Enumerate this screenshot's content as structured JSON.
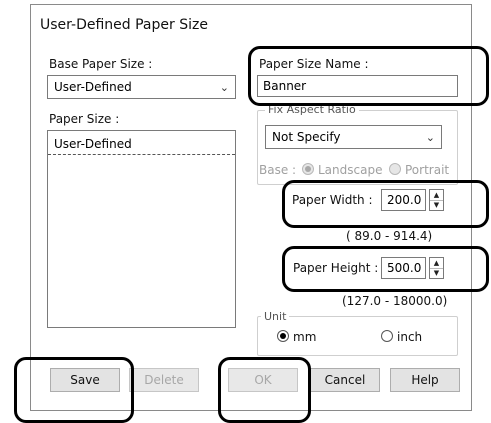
{
  "dialog": {
    "title": "User-Defined Paper Size"
  },
  "base_paper_size": {
    "label": "Base Paper Size :",
    "value": "User-Defined"
  },
  "paper_size": {
    "label": "Paper Size :",
    "items": [
      "User-Defined"
    ]
  },
  "paper_size_name": {
    "label": "Paper Size Name :",
    "value": "Banner"
  },
  "fix_aspect_ratio": {
    "label": "Fix Aspect Ratio",
    "value": "Not Specify",
    "base_label": "Base :",
    "landscape": "Landscape",
    "portrait": "Portrait",
    "selected": "Landscape"
  },
  "paper_width": {
    "label": "Paper Width  :",
    "value": "200.0",
    "range": "( 89.0 - 914.4)"
  },
  "paper_height": {
    "label": "Paper Height :",
    "value": "500.0",
    "range": "(127.0 - 18000.0)"
  },
  "unit": {
    "label": "Unit",
    "mm": "mm",
    "inch": "inch",
    "selected": "mm"
  },
  "buttons": {
    "save": "Save",
    "delete": "Delete",
    "ok": "OK",
    "cancel": "Cancel",
    "help": "Help"
  },
  "icons": {
    "dropdown": "chevron-down-icon",
    "spin_up": "spin-up-icon",
    "spin_down": "spin-down-icon"
  }
}
